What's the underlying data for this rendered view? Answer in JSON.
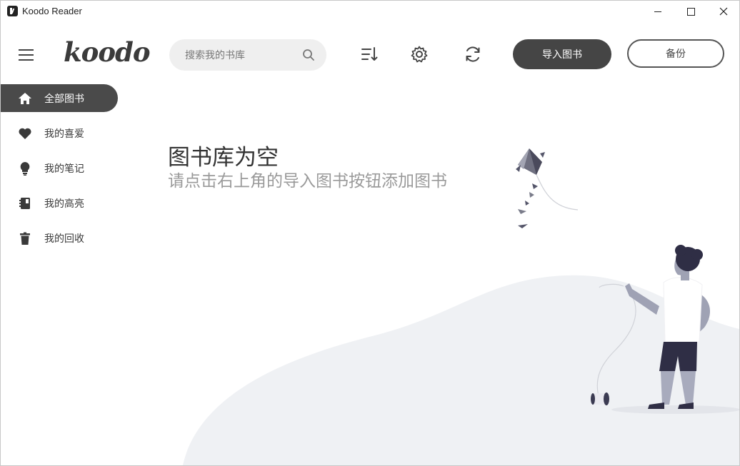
{
  "window": {
    "title": "Koodo Reader"
  },
  "header": {
    "logo": "koodo",
    "search_placeholder": "搜索我的书库",
    "import_label": "导入图书",
    "backup_label": "备份"
  },
  "sidebar": {
    "items": [
      {
        "label": "全部图书",
        "icon": "home-icon",
        "active": true
      },
      {
        "label": "我的喜爱",
        "icon": "heart-icon",
        "active": false
      },
      {
        "label": "我的笔记",
        "icon": "bulb-icon",
        "active": false
      },
      {
        "label": "我的高亮",
        "icon": "notebook-icon",
        "active": false
      },
      {
        "label": "我的回收",
        "icon": "trash-icon",
        "active": false
      }
    ]
  },
  "empty": {
    "title": "图书库为空",
    "subtitle": "请点击右上角的导入图书按钮添加图书"
  },
  "colors": {
    "accent": "#454545",
    "active_bg": "#4a4a4a",
    "muted_text": "#9a9a9a",
    "hill": "#eef0f3"
  }
}
